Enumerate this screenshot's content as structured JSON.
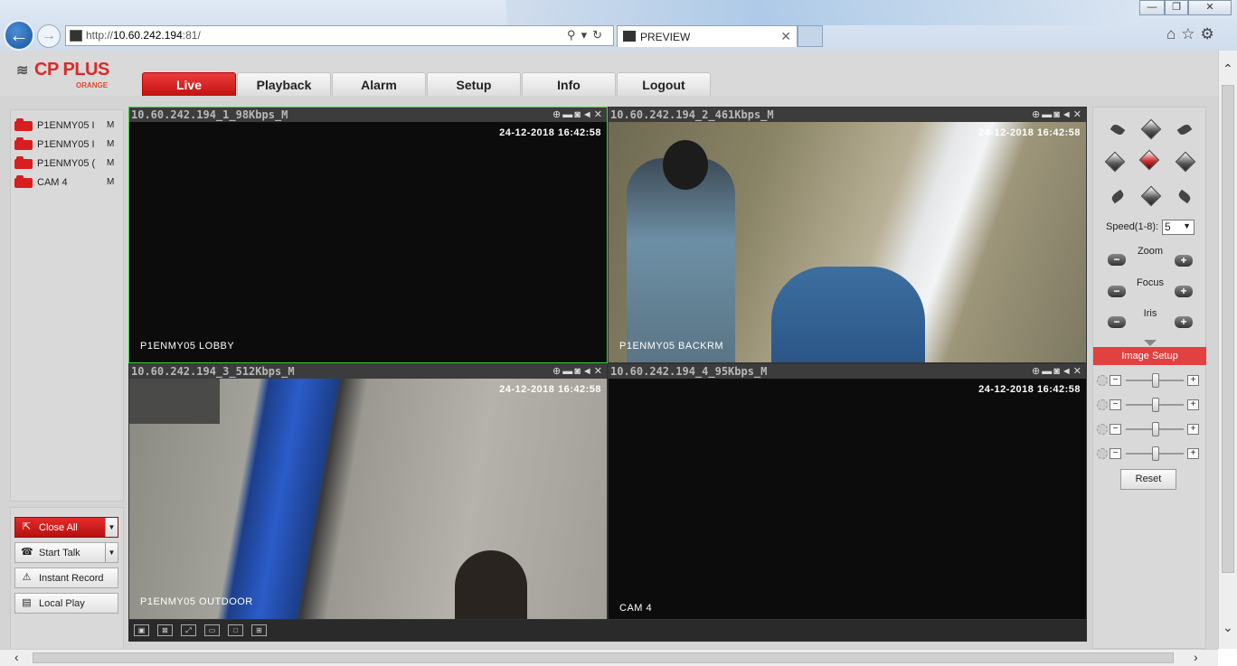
{
  "browser": {
    "url_prefix": "http://",
    "url_host": "10.60.242.194",
    "url_suffix": ":81/",
    "tab_title": "PREVIEW",
    "minimize": "—",
    "restore": "❐",
    "close": "✕"
  },
  "logo": {
    "mark": "≋",
    "text": "CP PLUS",
    "sub": "ORANGE"
  },
  "nav": [
    "Live",
    "Playback",
    "Alarm",
    "Setup",
    "Info",
    "Logout"
  ],
  "channels": [
    {
      "name": "P1ENMY05 I",
      "mode": "M"
    },
    {
      "name": "P1ENMY05 I",
      "mode": "M"
    },
    {
      "name": "P1ENMY05 (",
      "mode": "M"
    },
    {
      "name": "CAM 4",
      "mode": "M"
    }
  ],
  "actions": {
    "close_all": "Close All",
    "start_talk": "Start Talk",
    "instant_record": "Instant Record",
    "local_play": "Local Play"
  },
  "cameras": [
    {
      "title": "10.60.242.194_1_98Kbps_M",
      "time": "24-12-2018 16:42:58",
      "label": "P1ENMY05 LOBBY"
    },
    {
      "title": "10.60.242.194_2_461Kbps_M",
      "time": "24-12-2018 16:42:58",
      "label": "P1ENMY05 BACKRM"
    },
    {
      "title": "10.60.242.194_3_512Kbps_M",
      "time": "24-12-2018 16:42:58",
      "label": "P1ENMY05 OUTDOOR"
    },
    {
      "title": "10.60.242.194_4_95Kbps_M",
      "time": "24-12-2018 16:42:58",
      "label": "CAM 4"
    }
  ],
  "ptz": {
    "speed_label": "Speed(1-8):",
    "speed_value": "5",
    "zoom": "Zoom",
    "focus": "Focus",
    "iris": "Iris",
    "image_setup": "Image Setup",
    "reset": "Reset"
  },
  "colors": {
    "accent": "#d81e1e",
    "selected_border": "#3bd13b"
  }
}
